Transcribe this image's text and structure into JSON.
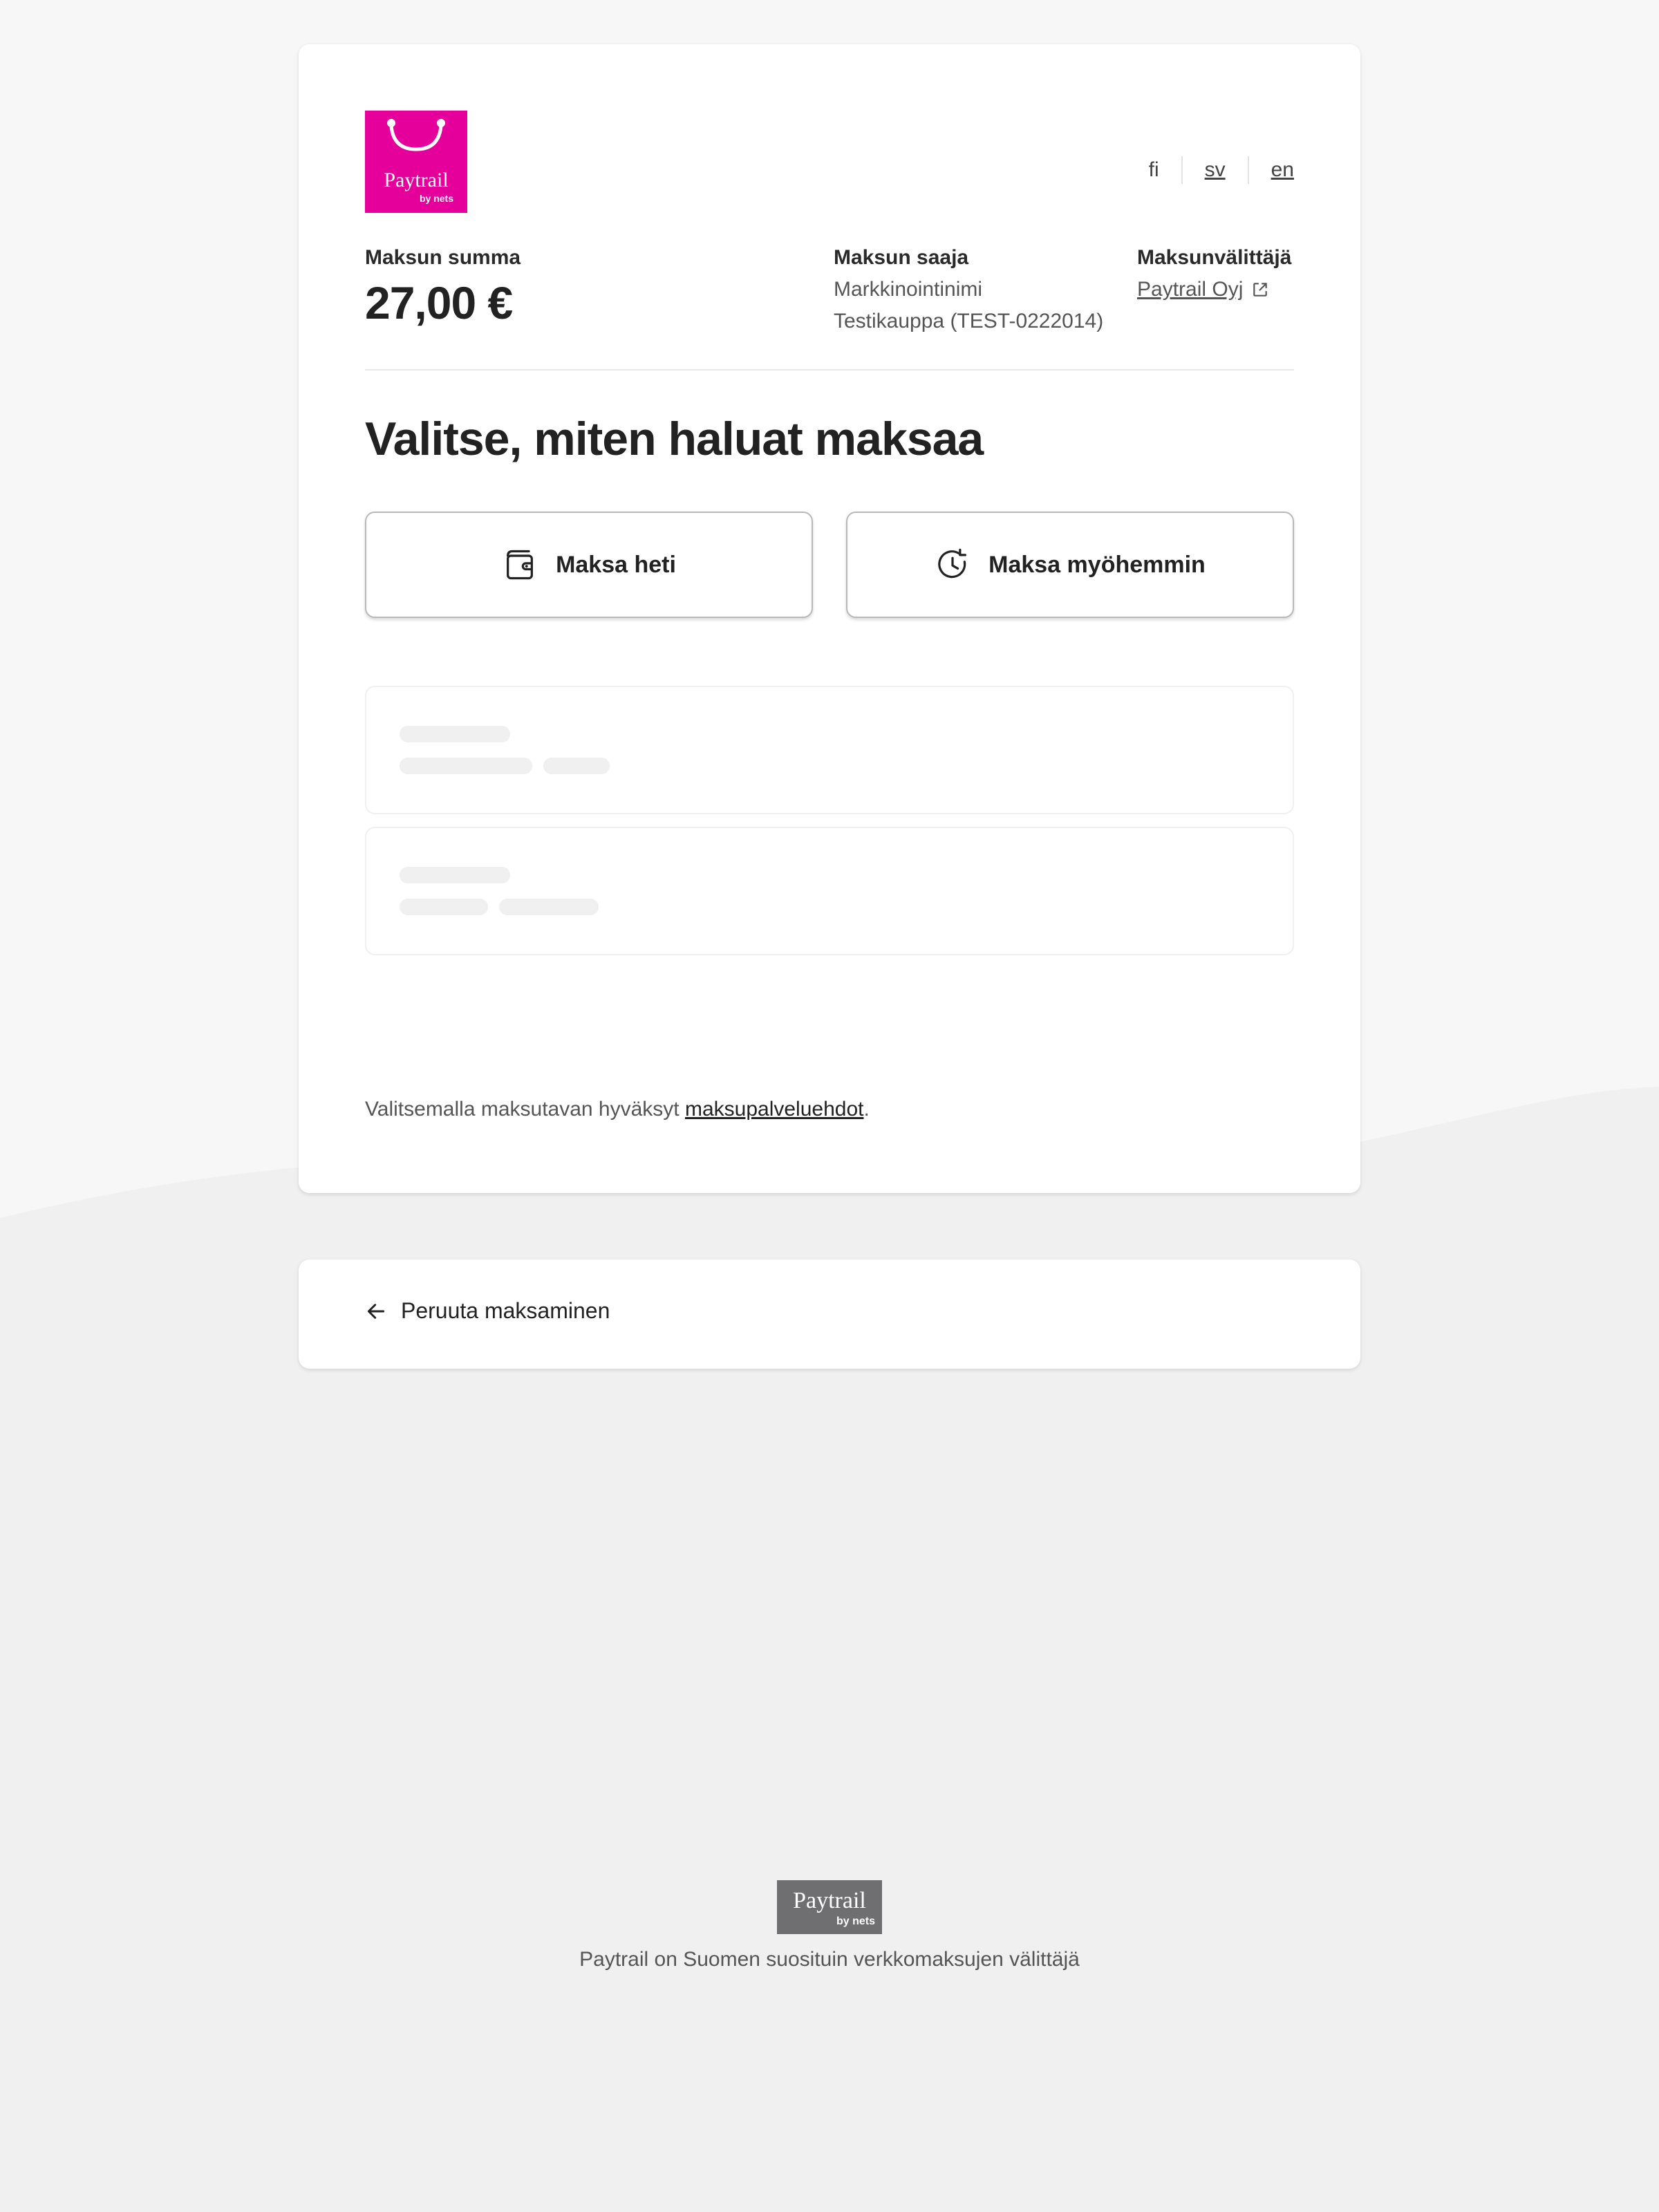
{
  "brand": {
    "logo_text": "Paytrail",
    "logo_subtext": "by nets",
    "accent_color": "#e5009b",
    "footer_logo_color": "#6f6f71"
  },
  "languages": [
    {
      "code": "fi",
      "active": true
    },
    {
      "code": "sv",
      "active": false
    },
    {
      "code": "en",
      "active": false
    }
  ],
  "payment_info": {
    "amount_label": "Maksun summa",
    "amount": "27,00 €",
    "payee_label": "Maksun saaja",
    "payee_name": "Markkinointinimi",
    "payee_detail": "Testikauppa (TEST-0222014)",
    "broker_label": "Maksunvälittäjä",
    "broker_link": "Paytrail Oyj"
  },
  "main": {
    "heading": "Valitse, miten haluat maksaa",
    "pay_now_label": "Maksa heti",
    "pay_later_label": "Maksa myöhemmin",
    "terms_prefix": "Valitsemalla maksutavan hyväksyt ",
    "terms_link": "maksupalveluehdot",
    "terms_suffix": "."
  },
  "cancel": {
    "label": "Peruuta maksaminen"
  },
  "footer": {
    "text": "Paytrail on Suomen suosituin verkkomaksujen välittäjä"
  },
  "icons": [
    "wallet-icon",
    "clock-refresh-icon",
    "external-link-icon",
    "arrow-left-icon"
  ]
}
